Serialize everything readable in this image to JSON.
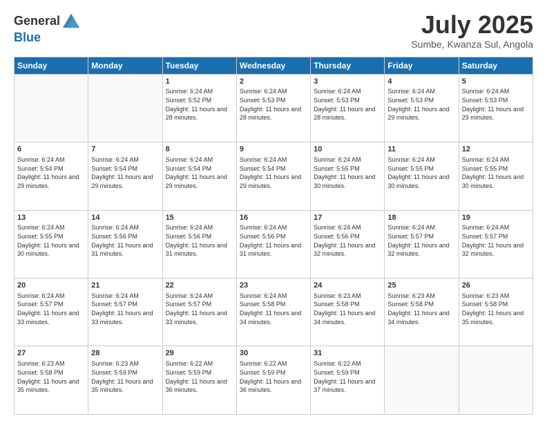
{
  "header": {
    "logo_general": "General",
    "logo_blue": "Blue",
    "month_title": "July 2025",
    "subtitle": "Sumbe, Kwanza Sul, Angola"
  },
  "days_of_week": [
    "Sunday",
    "Monday",
    "Tuesday",
    "Wednesday",
    "Thursday",
    "Friday",
    "Saturday"
  ],
  "weeks": [
    [
      {
        "day": "",
        "info": ""
      },
      {
        "day": "",
        "info": ""
      },
      {
        "day": "1",
        "info": "Sunrise: 6:24 AM\nSunset: 5:52 PM\nDaylight: 11 hours and 28 minutes."
      },
      {
        "day": "2",
        "info": "Sunrise: 6:24 AM\nSunset: 5:53 PM\nDaylight: 11 hours and 28 minutes."
      },
      {
        "day": "3",
        "info": "Sunrise: 6:24 AM\nSunset: 5:53 PM\nDaylight: 11 hours and 28 minutes."
      },
      {
        "day": "4",
        "info": "Sunrise: 6:24 AM\nSunset: 5:53 PM\nDaylight: 11 hours and 29 minutes."
      },
      {
        "day": "5",
        "info": "Sunrise: 6:24 AM\nSunset: 5:53 PM\nDaylight: 11 hours and 29 minutes."
      }
    ],
    [
      {
        "day": "6",
        "info": "Sunrise: 6:24 AM\nSunset: 5:54 PM\nDaylight: 11 hours and 29 minutes."
      },
      {
        "day": "7",
        "info": "Sunrise: 6:24 AM\nSunset: 5:54 PM\nDaylight: 11 hours and 29 minutes."
      },
      {
        "day": "8",
        "info": "Sunrise: 6:24 AM\nSunset: 5:54 PM\nDaylight: 11 hours and 29 minutes."
      },
      {
        "day": "9",
        "info": "Sunrise: 6:24 AM\nSunset: 5:54 PM\nDaylight: 11 hours and 29 minutes."
      },
      {
        "day": "10",
        "info": "Sunrise: 6:24 AM\nSunset: 5:55 PM\nDaylight: 11 hours and 30 minutes."
      },
      {
        "day": "11",
        "info": "Sunrise: 6:24 AM\nSunset: 5:55 PM\nDaylight: 11 hours and 30 minutes."
      },
      {
        "day": "12",
        "info": "Sunrise: 6:24 AM\nSunset: 5:55 PM\nDaylight: 11 hours and 30 minutes."
      }
    ],
    [
      {
        "day": "13",
        "info": "Sunrise: 6:24 AM\nSunset: 5:55 PM\nDaylight: 11 hours and 30 minutes."
      },
      {
        "day": "14",
        "info": "Sunrise: 6:24 AM\nSunset: 5:56 PM\nDaylight: 11 hours and 31 minutes."
      },
      {
        "day": "15",
        "info": "Sunrise: 6:24 AM\nSunset: 5:56 PM\nDaylight: 11 hours and 31 minutes."
      },
      {
        "day": "16",
        "info": "Sunrise: 6:24 AM\nSunset: 5:56 PM\nDaylight: 11 hours and 31 minutes."
      },
      {
        "day": "17",
        "info": "Sunrise: 6:24 AM\nSunset: 5:56 PM\nDaylight: 11 hours and 32 minutes."
      },
      {
        "day": "18",
        "info": "Sunrise: 6:24 AM\nSunset: 5:57 PM\nDaylight: 11 hours and 32 minutes."
      },
      {
        "day": "19",
        "info": "Sunrise: 6:24 AM\nSunset: 5:57 PM\nDaylight: 11 hours and 32 minutes."
      }
    ],
    [
      {
        "day": "20",
        "info": "Sunrise: 6:24 AM\nSunset: 5:57 PM\nDaylight: 11 hours and 33 minutes."
      },
      {
        "day": "21",
        "info": "Sunrise: 6:24 AM\nSunset: 5:57 PM\nDaylight: 11 hours and 33 minutes."
      },
      {
        "day": "22",
        "info": "Sunrise: 6:24 AM\nSunset: 5:57 PM\nDaylight: 11 hours and 33 minutes."
      },
      {
        "day": "23",
        "info": "Sunrise: 6:24 AM\nSunset: 5:58 PM\nDaylight: 11 hours and 34 minutes."
      },
      {
        "day": "24",
        "info": "Sunrise: 6:23 AM\nSunset: 5:58 PM\nDaylight: 11 hours and 34 minutes."
      },
      {
        "day": "25",
        "info": "Sunrise: 6:23 AM\nSunset: 5:58 PM\nDaylight: 11 hours and 34 minutes."
      },
      {
        "day": "26",
        "info": "Sunrise: 6:23 AM\nSunset: 5:58 PM\nDaylight: 11 hours and 35 minutes."
      }
    ],
    [
      {
        "day": "27",
        "info": "Sunrise: 6:23 AM\nSunset: 5:58 PM\nDaylight: 11 hours and 35 minutes."
      },
      {
        "day": "28",
        "info": "Sunrise: 6:23 AM\nSunset: 5:59 PM\nDaylight: 11 hours and 35 minutes."
      },
      {
        "day": "29",
        "info": "Sunrise: 6:22 AM\nSunset: 5:59 PM\nDaylight: 11 hours and 36 minutes."
      },
      {
        "day": "30",
        "info": "Sunrise: 6:22 AM\nSunset: 5:59 PM\nDaylight: 11 hours and 36 minutes."
      },
      {
        "day": "31",
        "info": "Sunrise: 6:22 AM\nSunset: 5:59 PM\nDaylight: 11 hours and 37 minutes."
      },
      {
        "day": "",
        "info": ""
      },
      {
        "day": "",
        "info": ""
      }
    ]
  ]
}
